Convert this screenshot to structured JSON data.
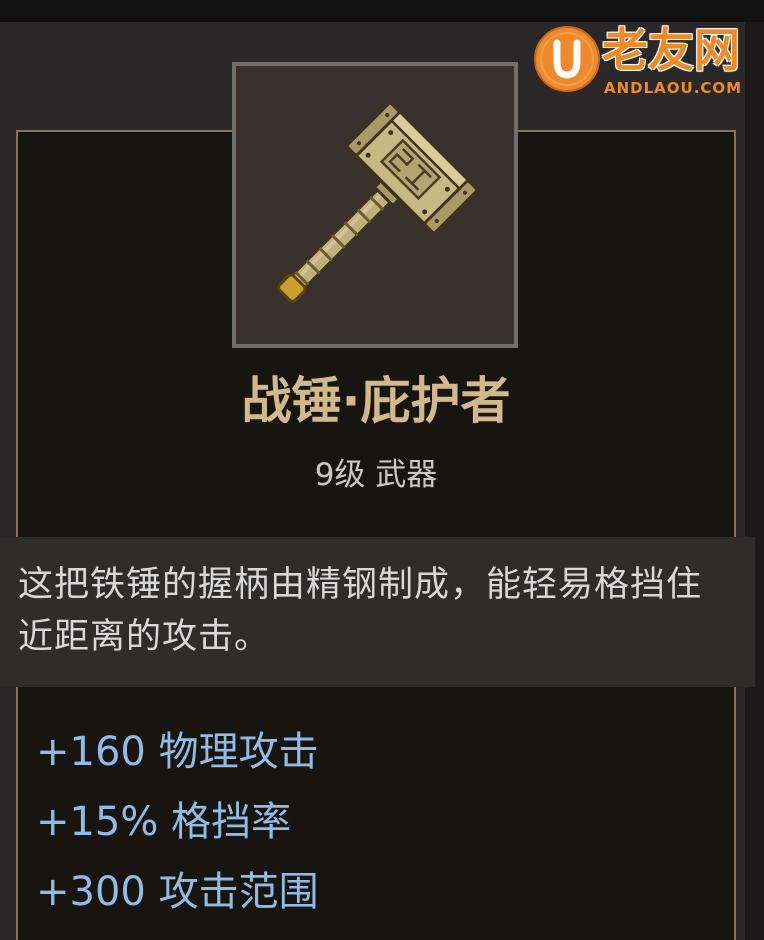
{
  "colors": {
    "page_bg": "#1c1a1b",
    "window_bg": "#2a2829",
    "panel_bg": "#18140f",
    "panel_border": "#86745a",
    "item_name": "#d2b98b",
    "item_level_type": "#c9c9c9",
    "description_bg": "#2f2c2c",
    "description_text": "#d8d8d8",
    "stat_text": "#8fbbe6",
    "watermark_orange": "#f08a26"
  },
  "watermark": {
    "logo_icon": "u-circle-logo-icon",
    "brand_name": "老友网",
    "domain": "ANDLAOU.COM"
  },
  "item": {
    "icon": "war-hammer-icon",
    "name": "战锤·庇护者",
    "level_type": "9级 武器",
    "description_lines": [
      "这把铁锤的握柄由精钢制成，能轻易格挡住",
      "近距离的攻击。"
    ],
    "stats": [
      "+160 物理攻击",
      "+15% 格挡率",
      "+300 攻击范围"
    ]
  }
}
